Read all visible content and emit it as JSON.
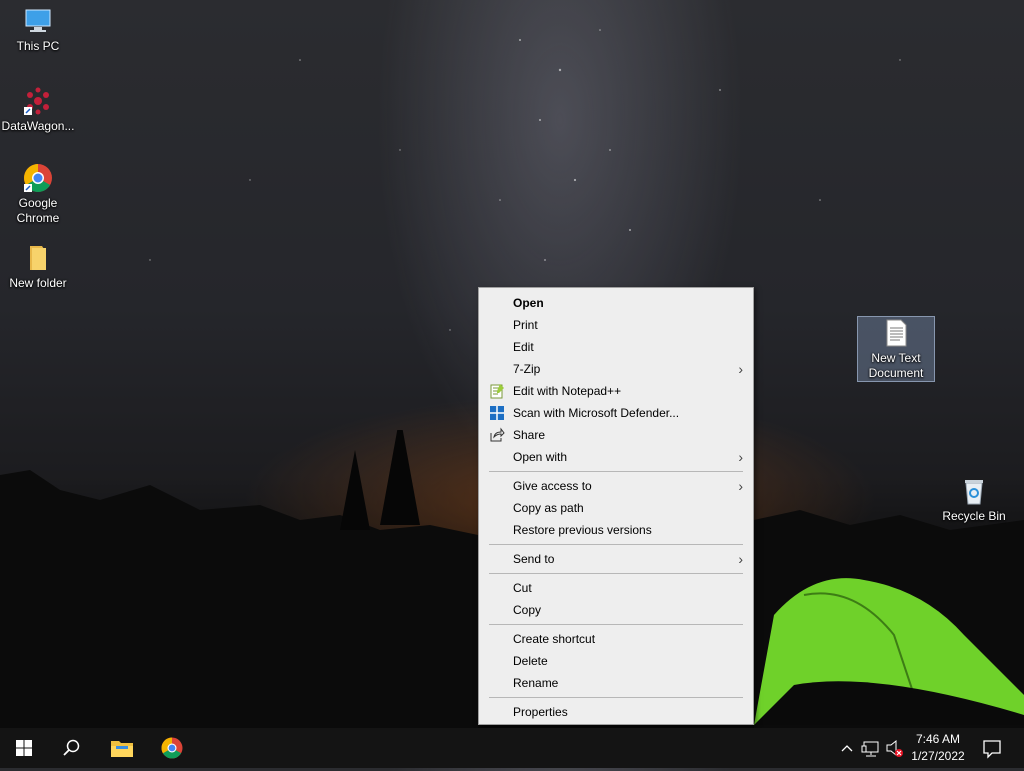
{
  "desktop": {
    "icons": [
      {
        "label": "This PC",
        "icon": "this-pc-icon"
      },
      {
        "label": "DataWagon...",
        "icon": "datawagon-icon"
      },
      {
        "label": "Google Chrome",
        "icon": "chrome-icon"
      },
      {
        "label": "New folder",
        "icon": "folder-icon"
      },
      {
        "label": "New Text Document",
        "icon": "text-document-icon",
        "selected": true
      },
      {
        "label": "Recycle Bin",
        "icon": "recycle-bin-icon"
      }
    ]
  },
  "context_menu": {
    "items": [
      {
        "label": "Open",
        "bold": true
      },
      {
        "label": "Print"
      },
      {
        "label": "Edit"
      },
      {
        "label": "7-Zip",
        "submenu": true
      },
      {
        "label": "Edit with Notepad++",
        "icon": "notepad-plus-plus-icon"
      },
      {
        "label": "Scan with Microsoft Defender...",
        "icon": "defender-icon"
      },
      {
        "label": "Share",
        "icon": "share-icon"
      },
      {
        "label": "Open with",
        "submenu": true
      },
      {
        "label": "Give access to",
        "submenu": true
      },
      {
        "label": "Copy as path"
      },
      {
        "label": "Restore previous versions"
      },
      {
        "label": "Send to",
        "submenu": true
      },
      {
        "label": "Cut"
      },
      {
        "label": "Copy"
      },
      {
        "label": "Create shortcut"
      },
      {
        "label": "Delete"
      },
      {
        "label": "Rename"
      },
      {
        "label": "Properties"
      }
    ]
  },
  "taskbar": {
    "buttons": [
      "start-icon",
      "search-icon",
      "file-explorer-icon",
      "chrome-icon"
    ],
    "tray_icons": [
      "chevron-up-icon",
      "network-icon",
      "volume-muted-icon",
      "notification-icon"
    ],
    "clock": {
      "time": "7:46 AM",
      "date": "1/27/2022"
    }
  },
  "colors": {
    "menu_bg": "#eeeeee",
    "taskbar_bg": "#141414",
    "tent_green": "#6fd12a",
    "selection": "#7f93b0"
  }
}
